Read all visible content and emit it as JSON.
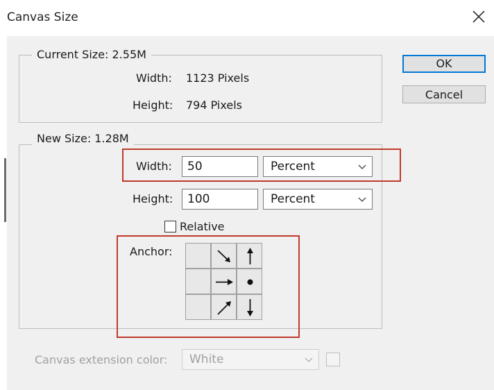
{
  "window": {
    "title": "Canvas Size"
  },
  "current_size": {
    "legend": "Current Size: 2.55M",
    "width_label": "Width:",
    "width_value": "1123 Pixels",
    "height_label": "Height:",
    "height_value": "794 Pixels"
  },
  "new_size": {
    "legend": "New Size: 1.28M",
    "width_label": "Width:",
    "width_value": "50",
    "width_unit": "Percent",
    "height_label": "Height:",
    "height_value": "100",
    "height_unit": "Percent",
    "relative_label": "Relative",
    "relative_checked": false,
    "anchor_label": "Anchor:"
  },
  "buttons": {
    "ok": "OK",
    "cancel": "Cancel"
  },
  "extension": {
    "label": "Canvas extension color:",
    "value": "White"
  },
  "colors": {
    "annotation": "#c0392b",
    "focus": "#0078d7"
  }
}
